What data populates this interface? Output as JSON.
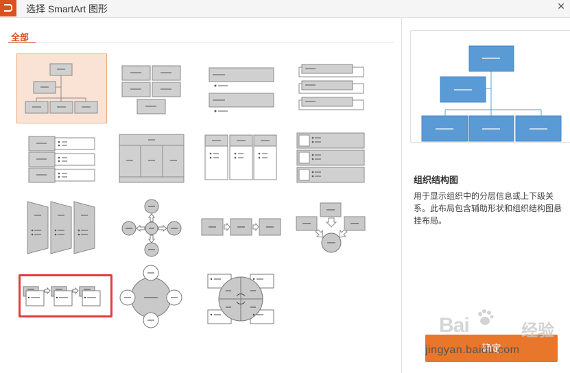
{
  "window": {
    "title": "选择 SmartArt 图形",
    "close_glyph": "✕"
  },
  "category_tab": {
    "label": "全部"
  },
  "gallery": {
    "selected_index": 0,
    "items": [
      "organization-chart",
      "block-list",
      "vertical-bullet-list",
      "bracket-list",
      "label-list",
      "table-hierarchy",
      "column-list",
      "picture-accent-list",
      "trapezoid-list",
      "radial-cycle",
      "basic-process",
      "converging-arrows",
      "staggered-process",
      "radial-venn",
      "matrix-cycle"
    ]
  },
  "detail": {
    "title": "组织结构图",
    "description": "用于显示组织中的分层信息或上下级关系。此布局包含辅助形状和组织结构图悬挂布局。"
  },
  "ok_button": {
    "label": "确定"
  },
  "watermark": {
    "brand": "Bai",
    "brand_cn": "经验",
    "url": "jingyan.baidu.com"
  },
  "colors": {
    "accent": "#d9531e",
    "button": "#e8762b",
    "preview_blue": "#5b9bd5",
    "thumb_gray": "#c9c9c9",
    "highlight_red": "#e03c3c"
  }
}
